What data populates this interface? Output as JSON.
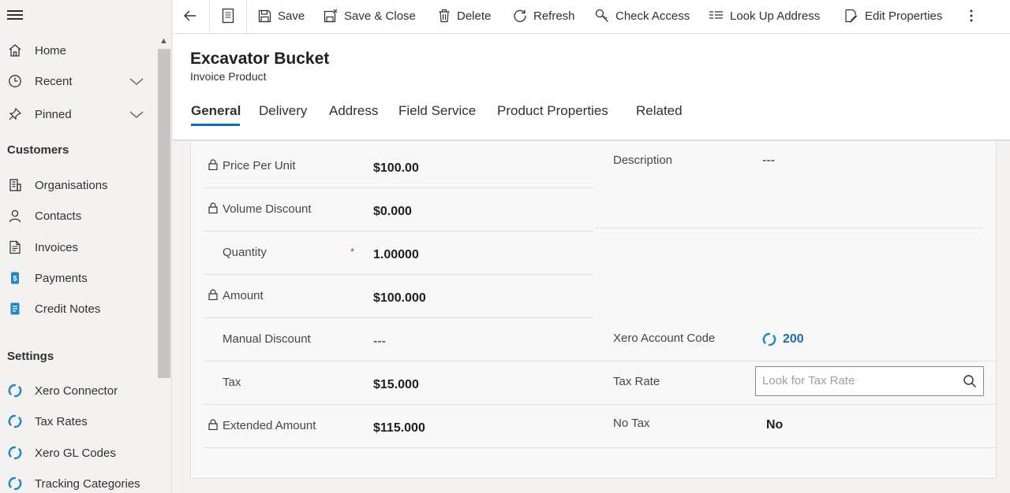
{
  "sidebar": {
    "items": [
      {
        "label": "Home",
        "icon": "home-icon"
      },
      {
        "label": "Recent",
        "icon": "clock-icon"
      },
      {
        "label": "Pinned",
        "icon": "pin-icon"
      }
    ],
    "sections": [
      {
        "title": "Customers",
        "items": [
          {
            "label": "Organisations",
            "icon": "building-icon"
          },
          {
            "label": "Contacts",
            "icon": "person-icon"
          },
          {
            "label": "Invoices",
            "icon": "document-icon"
          },
          {
            "label": "Payments",
            "icon": "payment-icon"
          },
          {
            "label": "Credit Notes",
            "icon": "credit-note-icon"
          }
        ]
      },
      {
        "title": "Settings",
        "items": [
          {
            "label": "Xero Connector",
            "icon": "xero-icon"
          },
          {
            "label": "Tax Rates",
            "icon": "xero-icon"
          },
          {
            "label": "Xero GL Codes",
            "icon": "xero-icon"
          },
          {
            "label": "Tracking Categories",
            "icon": "xero-icon"
          }
        ]
      }
    ]
  },
  "commandbar": {
    "items": [
      {
        "label": "Save",
        "icon": "save-icon"
      },
      {
        "label": "Save & Close",
        "icon": "save-close-icon"
      },
      {
        "label": "Delete",
        "icon": "trash-icon"
      },
      {
        "label": "Refresh",
        "icon": "refresh-icon"
      },
      {
        "label": "Check Access",
        "icon": "key-icon"
      },
      {
        "label": "Look Up Address",
        "icon": "address-icon"
      },
      {
        "label": "Edit Properties",
        "icon": "edit-icon"
      }
    ]
  },
  "header": {
    "title": "Excavator Bucket",
    "subtitle": "Invoice Product",
    "tabs": [
      {
        "label": "General",
        "active": true
      },
      {
        "label": "Delivery"
      },
      {
        "label": "Address"
      },
      {
        "label": "Field Service"
      },
      {
        "label": "Product Properties"
      },
      {
        "label": "Related"
      }
    ]
  },
  "form": {
    "left_fields": [
      {
        "label": "Price Per Unit",
        "value": "$100.00",
        "locked": true
      },
      {
        "label": "Volume Discount",
        "value": "$0.000",
        "locked": true
      },
      {
        "label": "Quantity",
        "value": "1.00000",
        "required": "*"
      },
      {
        "label": "Amount",
        "value": "$100.000",
        "locked": true
      },
      {
        "label": "Manual Discount",
        "value": "---",
        "empty": true
      },
      {
        "label": "Tax",
        "value": "$15.000"
      },
      {
        "label": "Extended Amount",
        "value": "$115.000",
        "locked": true
      }
    ],
    "description": {
      "label": "Description",
      "value": "---"
    },
    "xero_account_code": {
      "label": "Xero Account Code",
      "value": "200"
    },
    "tax_rate": {
      "label": "Tax Rate",
      "placeholder": "Look for Tax Rate"
    },
    "no_tax": {
      "label": "No Tax",
      "value": "No"
    }
  },
  "colors": {
    "accent": "#0f6cbd",
    "xero": "#1e88c7",
    "required": "#c4314b"
  }
}
